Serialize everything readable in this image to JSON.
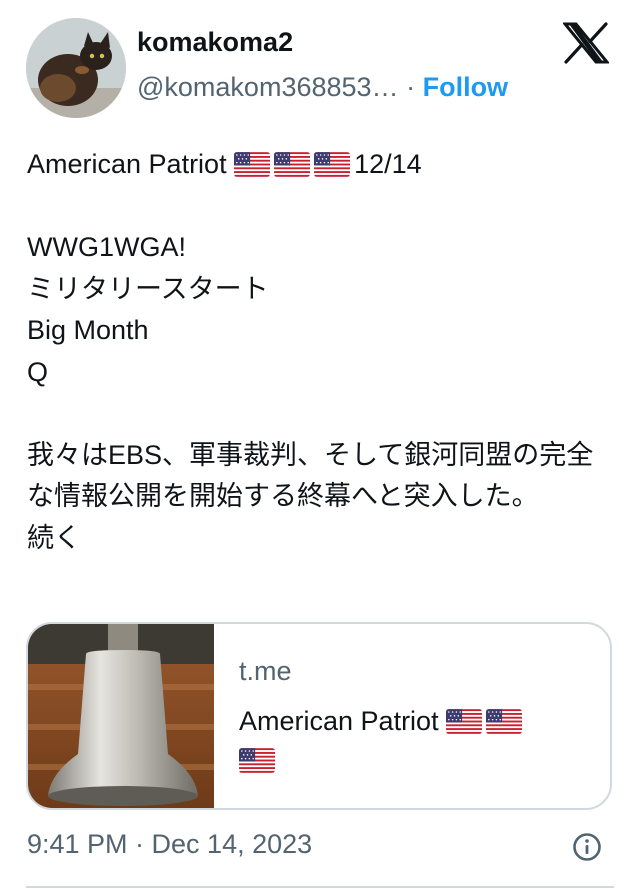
{
  "author": {
    "display_name": "komakoma2",
    "handle": "@komakom368853…",
    "separator": "·",
    "follow_label": "Follow"
  },
  "icons": {
    "logo": "x-logo-icon",
    "avatar": "cat-avatar",
    "flag": "us-flag-icon",
    "info": "info-icon"
  },
  "tweet": {
    "line1_text": "American Patriot ",
    "line1_suffix": "12/14",
    "line2": "WWG1WGA!",
    "line3": "ミリタリースタート",
    "line4": "Big Month",
    "line5": "Q",
    "line6": "我々はEBS、軍事裁判、そして銀河同盟の完全な情報公開を開始する終幕へと突入した。",
    "line7": "続く"
  },
  "link_card": {
    "domain": "t.me",
    "title": "American Patriot "
  },
  "footer": {
    "timestamp": "9:41 PM · Dec 14, 2023"
  },
  "colors": {
    "text": "#0f1419",
    "secondary": "#536471",
    "accent": "#1d9bf0",
    "border": "#cfd9de"
  }
}
